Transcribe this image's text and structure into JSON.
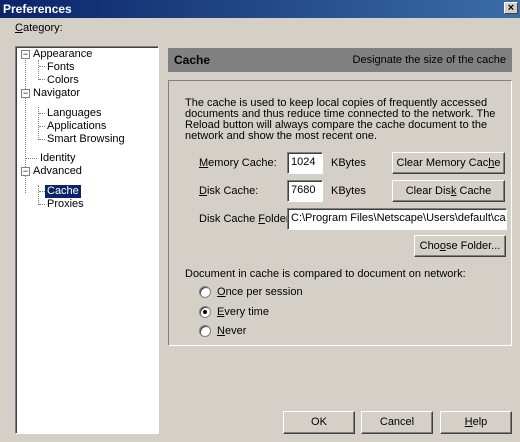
{
  "window": {
    "title": "Preferences",
    "close_glyph": "×"
  },
  "category": {
    "label_prefix": "C",
    "label_rest": "ategory:"
  },
  "tree": {
    "appearance": "Appearance",
    "fonts": "Fonts",
    "colors": "Colors",
    "navigator": "Navigator",
    "languages": "Languages",
    "applications": "Applications",
    "smart_browsing": "Smart Browsing",
    "identity": "Identity",
    "advanced": "Advanced",
    "cache": "Cache",
    "proxies": "Proxies",
    "expander_glyph": "−"
  },
  "panel": {
    "title": "Cache",
    "description": "Designate the size of the cache",
    "intro": "The cache is used to keep local copies of frequently accessed documents and thus reduce time connected to the network. The Reload button will always compare the cache document to the network and show the most recent one.",
    "memory_label_u": "M",
    "memory_label_rest": "emory Cache:",
    "memory_value": "1024",
    "memory_unit": "KBytes",
    "clear_memory_pre": "Clear Memory Cac",
    "clear_memory_u": "h",
    "clear_memory_post": "e",
    "disk_label_u": "D",
    "disk_label_rest": "isk Cache:",
    "disk_value": "7680",
    "disk_unit": "KBytes",
    "clear_disk_pre": "Clear Dis",
    "clear_disk_u": "k",
    "clear_disk_post": " Cache",
    "folder_label_pre": "Disk Cache ",
    "folder_label_u": "F",
    "folder_label_post": "older:",
    "folder_value": "C:\\Program Files\\Netscape\\Users\\default\\cache",
    "choose_pre": "Cho",
    "choose_u": "o",
    "choose_post": "se Folder...",
    "compare_text": "Document in cache is compared to document on network:",
    "radios": [
      {
        "u": "O",
        "rest": "nce per session",
        "checked": false
      },
      {
        "u": "E",
        "rest": "very time",
        "checked": true
      },
      {
        "u": "N",
        "rest": "ever",
        "checked": false
      }
    ]
  },
  "footer": {
    "ok": "OK",
    "cancel": "Cancel",
    "help_u": "H",
    "help_rest": "elp"
  }
}
